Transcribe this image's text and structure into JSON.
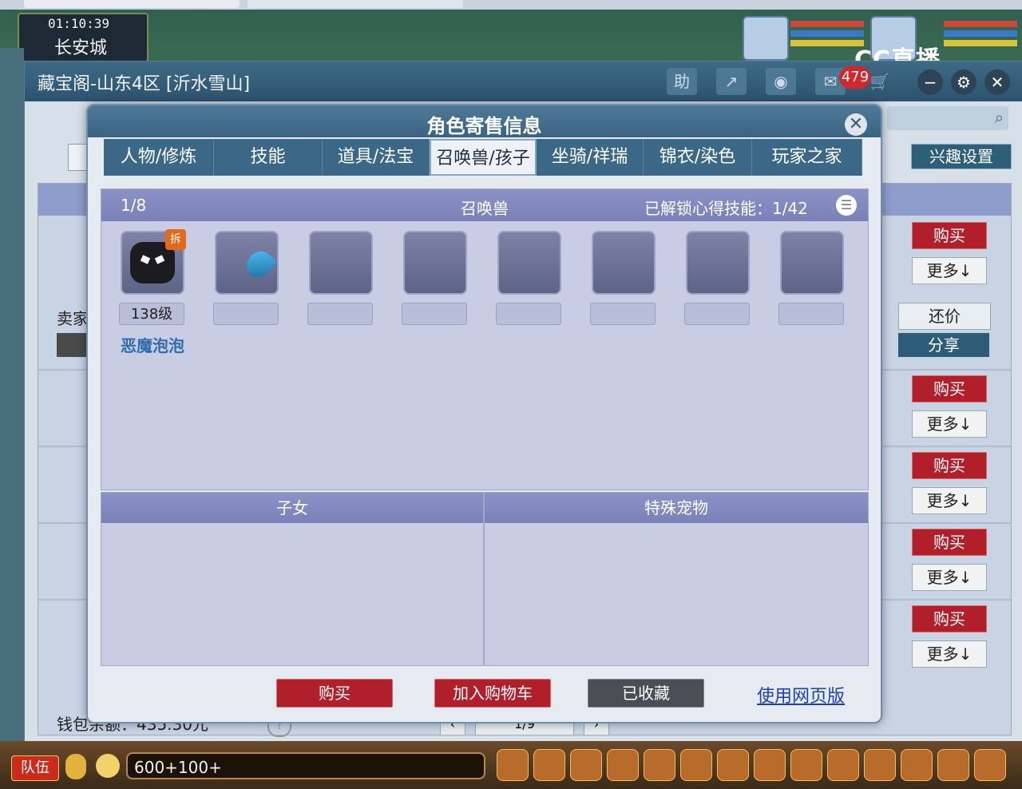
{
  "game": {
    "clock": "01:10:39",
    "city": "长安城",
    "broadcast_logo": "CC直播"
  },
  "main_window": {
    "title": "藏宝阁-山东4区 [沂水雪山]",
    "help_label": "助",
    "notification_count": "479",
    "interest_settings": "兴趣设置",
    "seller_label": "卖家",
    "wallet_text": "钱包余额：435.30元",
    "pager_text": "1/9",
    "counter_offer": "还价",
    "share": "分享",
    "rows": [
      {
        "buy": "购买",
        "more": "更多↓"
      },
      {
        "buy": "购买",
        "more": "更多↓"
      },
      {
        "buy": "购买",
        "more": "更多↓"
      },
      {
        "buy": "购买",
        "more": "更多↓"
      },
      {
        "buy": "购买",
        "more": "更多↓"
      }
    ]
  },
  "dialog": {
    "title": "角色寄售信息",
    "tabs": [
      {
        "label": "人物/修炼"
      },
      {
        "label": "技能"
      },
      {
        "label": "道具/法宝"
      },
      {
        "label": "召唤兽/孩子",
        "active": true
      },
      {
        "label": "坐骑/祥瑞"
      },
      {
        "label": "锦衣/染色"
      },
      {
        "label": "玩家之家"
      }
    ],
    "pets_panel": {
      "count": "1/8",
      "label": "召唤兽",
      "skills_unlocked": "已解锁心得技能：1/42",
      "pets": [
        {
          "level": "138级",
          "name": "恶魔泡泡",
          "badge": "拆"
        }
      ]
    },
    "children_label": "子女",
    "special_pets_label": "特殊宠物",
    "buttons": {
      "buy": "购买",
      "add_to_cart": "加入购物车",
      "favorited": "已收藏",
      "web_version": "使用网页版"
    }
  },
  "bottom_bar": {
    "team_button": "队伍",
    "chat_input_value": "600+100+"
  },
  "colors": {
    "dialog_header": "#3a6482",
    "buy_red": "#b1202a",
    "pet_panel_header": "#7a81b8",
    "link_blue": "#1e3fae"
  }
}
